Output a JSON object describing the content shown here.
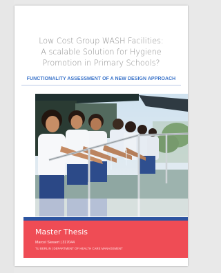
{
  "document": {
    "title_lines": [
      "Low Cost Group WASH Facilities:",
      "A scalable Solution for Hygiene",
      "Promotion in Primary Schools?"
    ],
    "subtitle": "FUNCTIONALITY ASSESSMENT OF A NEW DESIGN APPROACH",
    "footer": {
      "heading": "Master Thesis",
      "author_line": "Marcel Siewert  |  317044",
      "institution_line": "TU BERLIN | DEPARTMENT OF HEALTH CARE MANAGEMENT"
    }
  },
  "colors": {
    "footer_band": "#ef4c55",
    "footer_accent": "#2c54a0",
    "subtitle_text": "#3a73c9",
    "title_text": "#8c8c8c"
  }
}
